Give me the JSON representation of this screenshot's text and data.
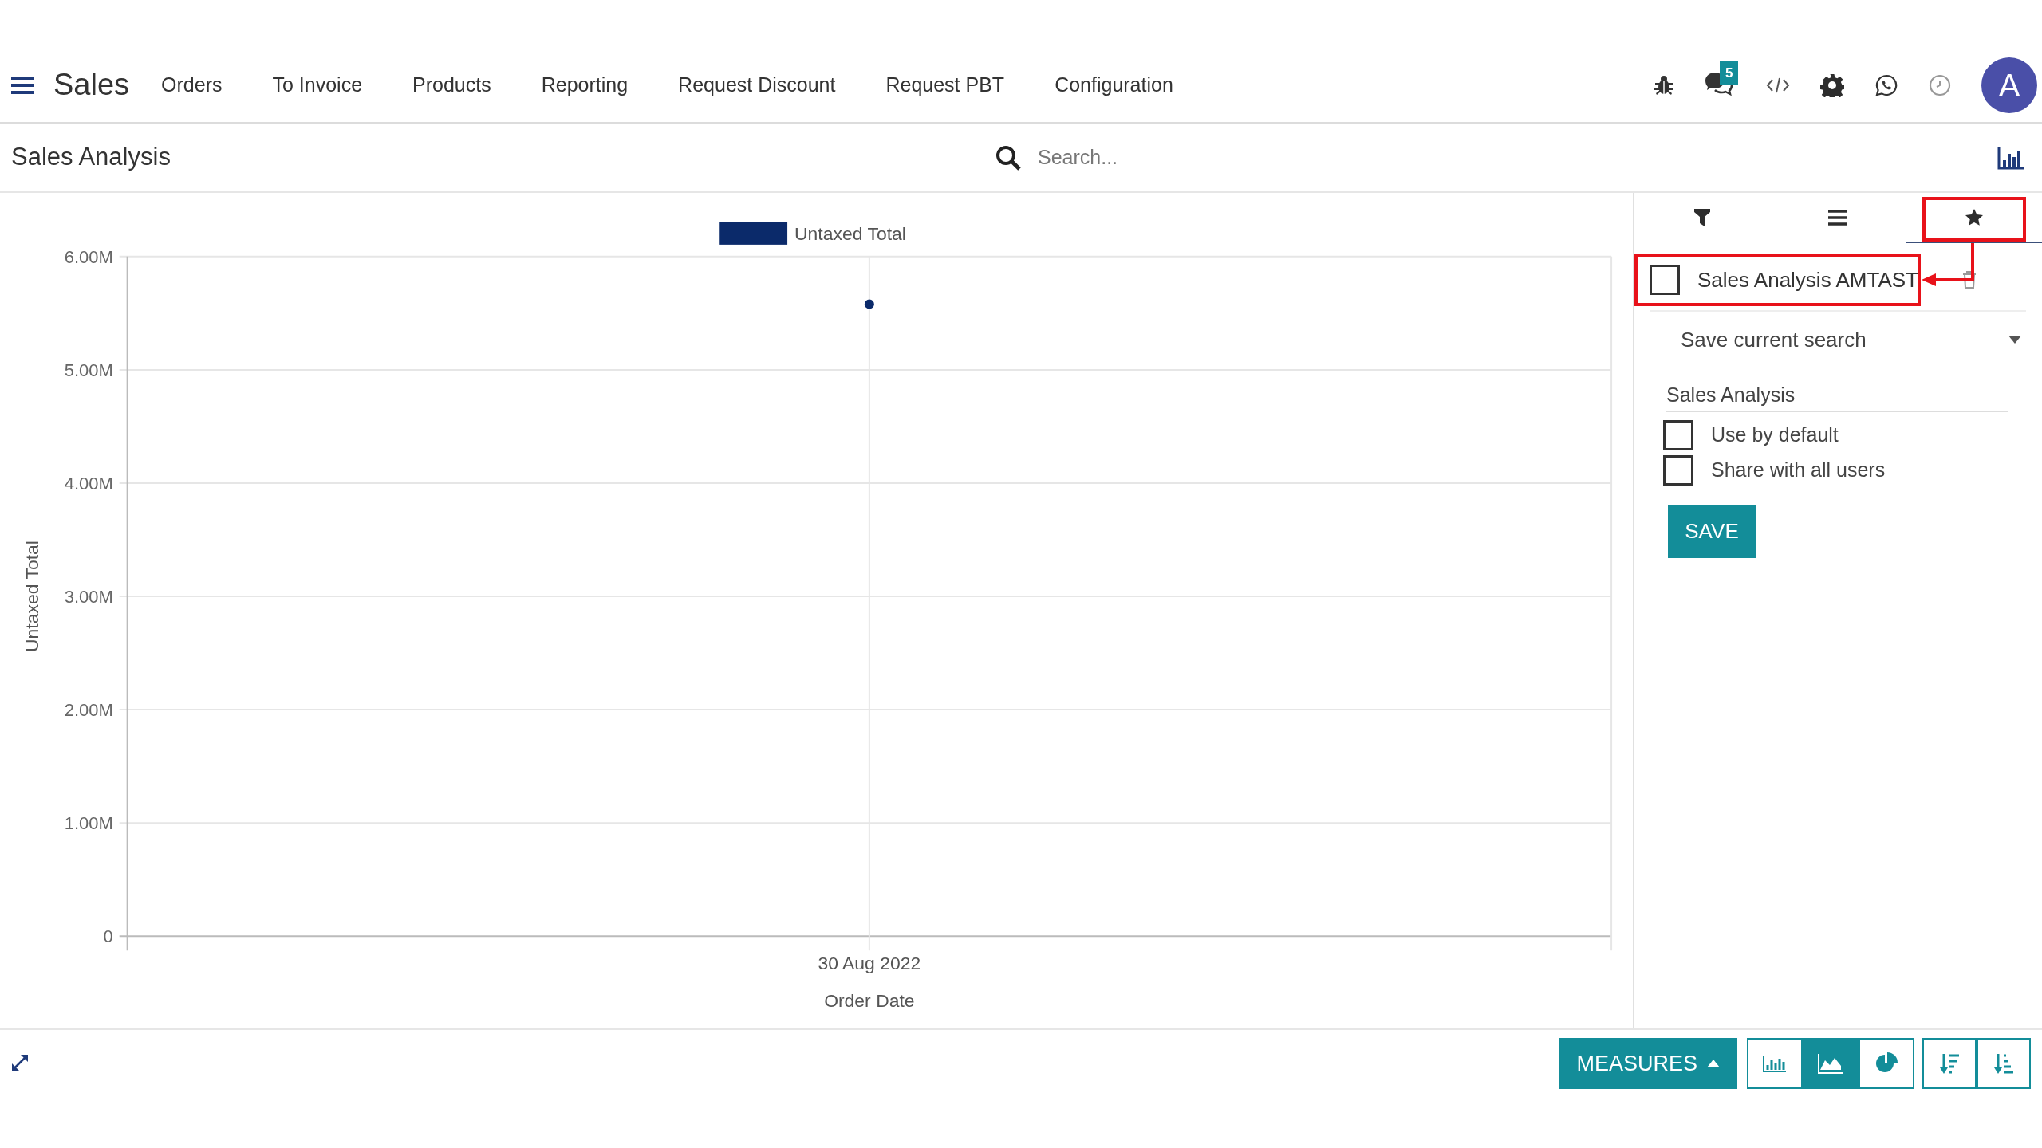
{
  "navbar": {
    "app_name": "Sales",
    "menu": [
      "Orders",
      "To Invoice",
      "Products",
      "Reporting",
      "Request Discount",
      "Request PBT",
      "Configuration"
    ],
    "messages_badge": "5",
    "avatar_letter": "A"
  },
  "control_panel": {
    "title": "Sales Analysis",
    "search": {
      "placeholder": "Search..."
    }
  },
  "chart": {
    "chart_data": {
      "type": "line",
      "xlabel": "Order Date",
      "ylabel": "Untaxed Total",
      "categories": [
        "30 Aug 2022"
      ],
      "grid": true,
      "series": [
        {
          "name": "Untaxed Total",
          "color": "#0b2a6a",
          "marker": true,
          "values": [
            5580000
          ]
        }
      ],
      "ylim": [
        0,
        6000000
      ],
      "yticks": [
        {
          "value": 0,
          "label": "0"
        },
        {
          "value": 1000000,
          "label": "1.00M"
        },
        {
          "value": 2000000,
          "label": "2.00M"
        },
        {
          "value": 3000000,
          "label": "3.00M"
        },
        {
          "value": 4000000,
          "label": "4.00M"
        },
        {
          "value": 5000000,
          "label": "5.00M"
        },
        {
          "value": 6000000,
          "label": "6.00M"
        }
      ]
    }
  },
  "side_panel": {
    "tabs": [
      {
        "kind": "filters",
        "selected": false,
        "highlighted": false
      },
      {
        "kind": "group_by",
        "selected": false,
        "highlighted": false
      },
      {
        "kind": "favorites",
        "selected": true,
        "highlighted": true
      }
    ],
    "favorites": [
      {
        "label": "Sales Analysis AMTAST",
        "checked": false,
        "highlighted": true
      }
    ],
    "save_search": {
      "label": "Save current search",
      "expanded": true,
      "name_value": "Sales Analysis",
      "options": [
        {
          "label": "Use by default",
          "checked": false
        },
        {
          "label": "Share with all users",
          "checked": false
        }
      ],
      "save_button": "SAVE"
    }
  },
  "bottom_bar": {
    "measures_button": "MEASURES",
    "chart_types": [
      {
        "kind": "bar",
        "selected": false
      },
      {
        "kind": "line",
        "selected": true
      },
      {
        "kind": "pie",
        "selected": false
      }
    ],
    "sort_buttons": [
      {
        "kind": "descending"
      },
      {
        "kind": "ascending"
      }
    ]
  }
}
